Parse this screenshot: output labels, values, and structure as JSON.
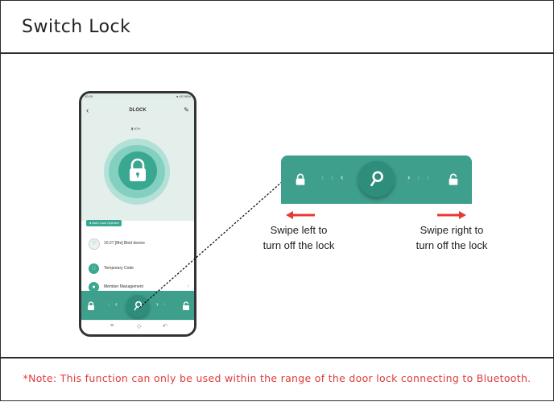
{
  "header": {
    "title": "Switch Lock"
  },
  "phone": {
    "status_time": "10:29",
    "status_right": "● 4G 56%",
    "app_title": "DLOCK",
    "battery": "60%",
    "auto_lock_label": "Auto Lock Opened",
    "list": {
      "bell_label": "10:27 [Me] Bind device",
      "code_label": "Temporary Code",
      "member_label": "Member Management"
    }
  },
  "captions": {
    "left": [
      "Swipe left to",
      "turn off the lock"
    ],
    "right": [
      "Swipe right to",
      "turn off the lock"
    ]
  },
  "footer": {
    "note": "*Note: This function can only be used within the range of the door lock connecting to Bluetooth."
  },
  "colors": {
    "teal": "#3d9f8c",
    "teal_dark": "#2f8e7b",
    "note_red": "#e03a3a",
    "arrow_red": "#e53935"
  },
  "icons": [
    "back-icon",
    "edit-icon",
    "lock-icon",
    "bell-icon",
    "grid-icon",
    "person-icon",
    "key-icon",
    "unlock-icon"
  ]
}
